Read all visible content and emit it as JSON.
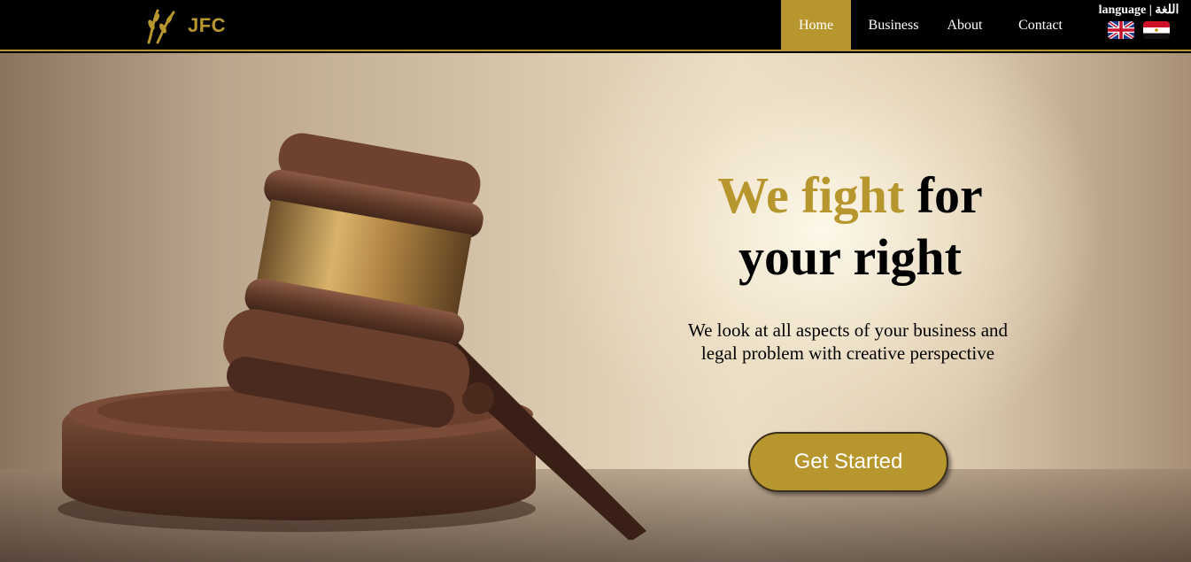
{
  "brand": {
    "name": "JFC",
    "logo_icon": "wheat-icon",
    "accent_color": "#b8962e"
  },
  "nav": {
    "items": [
      {
        "label": "Home",
        "active": true
      },
      {
        "label": "Business",
        "active": false
      },
      {
        "label": "About",
        "active": false
      },
      {
        "label": "Contact",
        "active": false
      }
    ]
  },
  "language": {
    "label": "language | اللغة",
    "options": [
      {
        "name": "English",
        "icon": "uk-flag-icon"
      },
      {
        "name": "Arabic",
        "icon": "egypt-flag-icon"
      }
    ]
  },
  "hero": {
    "title_accent": "We fight",
    "title_rest_line1": " for",
    "title_line2": "your right",
    "subtitle": "We look at all aspects of your business and legal problem with creative perspective",
    "cta_label": "Get Started",
    "image": "gavel-image"
  }
}
